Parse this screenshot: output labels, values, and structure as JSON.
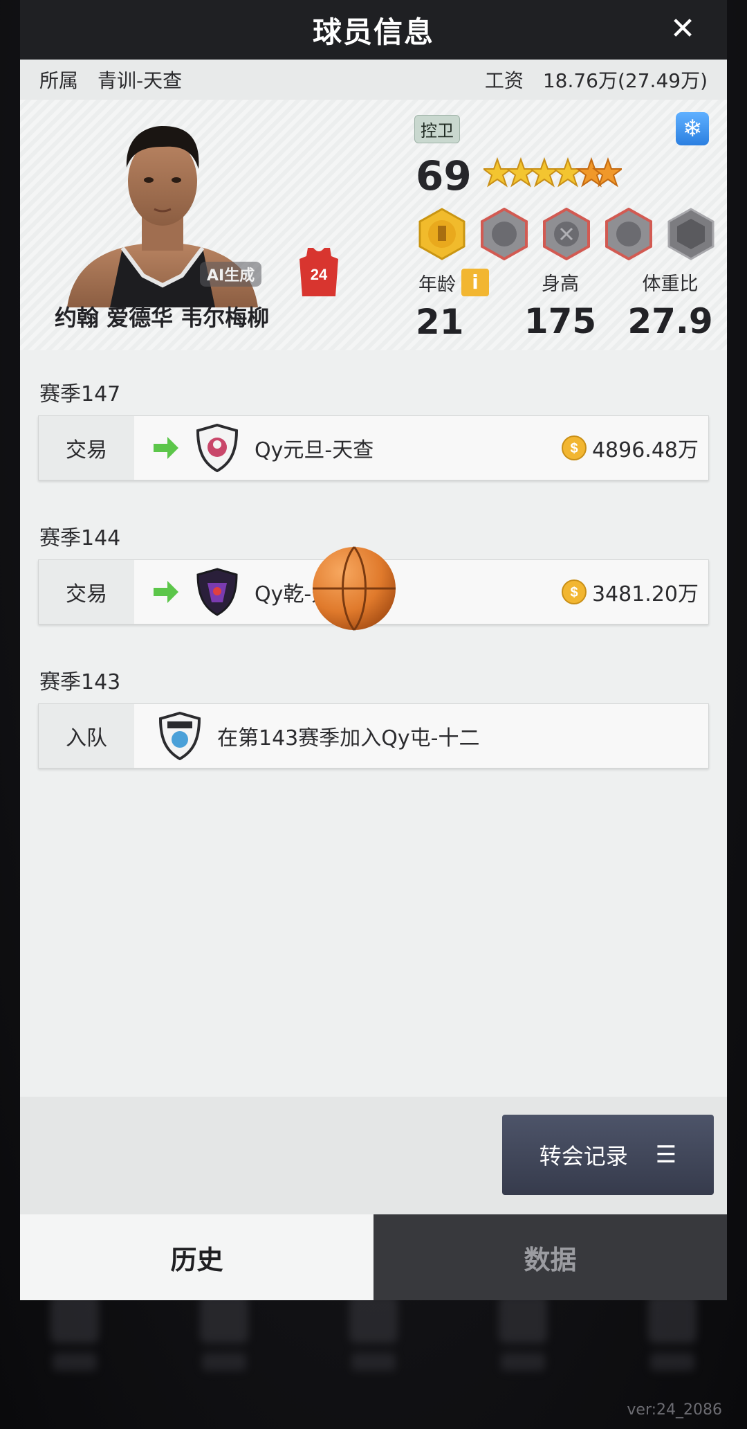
{
  "header": {
    "title": "球员信息"
  },
  "info_bar": {
    "team_label": "所属",
    "team_value": "青训-天查",
    "salary_label": "工资",
    "salary_value": "18.76万(27.49万)"
  },
  "player": {
    "name": "约翰 爱德华 韦尔梅柳",
    "ai_tag": "AI生成",
    "jersey_number": "24",
    "position": "控卫",
    "rating": "69",
    "stars": 4.5,
    "stats": [
      {
        "label": "年龄",
        "value": "21"
      },
      {
        "label": "身高",
        "value": "175"
      },
      {
        "label": "体重比",
        "value": "27.9"
      }
    ]
  },
  "history": [
    {
      "season": "赛季147",
      "type": "交易",
      "team": "Qy元旦-天查",
      "fee": "4896.48万"
    },
    {
      "season": "赛季144",
      "type": "交易",
      "team": "Qy乾-天",
      "fee": "3481.20万"
    },
    {
      "season": "赛季143",
      "type": "入队",
      "team": "在第143赛季加入Qy屯-十二",
      "fee": ""
    }
  ],
  "transfer_button": {
    "label": "转会记录"
  },
  "tabs": [
    {
      "label": "历史",
      "active": true
    },
    {
      "label": "数据",
      "active": false
    }
  ],
  "version": "ver:24_2086",
  "colors": {
    "header_bg": "#1f2023",
    "modal_bg": "#eef0f0",
    "arrow_green": "#5cc64a",
    "coin_gold": "#f2b631",
    "transfer_btn": "#434a5d"
  }
}
